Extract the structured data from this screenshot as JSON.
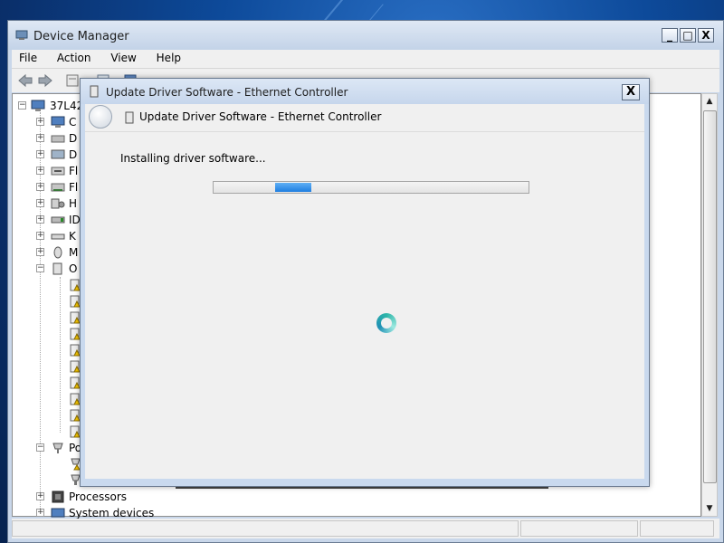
{
  "device_manager": {
    "title": "Device Manager",
    "menu": [
      "File",
      "Action",
      "View",
      "Help"
    ],
    "caption_buttons": {
      "minimize": "_",
      "maximize": "□",
      "close": "X"
    },
    "tree": {
      "root": "37L42",
      "nodes": [
        {
          "label": "C",
          "icon": "computer-icon",
          "expanded": false
        },
        {
          "label": "D",
          "icon": "disk-drive-icon",
          "expanded": false
        },
        {
          "label": "D",
          "icon": "display-adapter-icon",
          "expanded": false
        },
        {
          "label": "Fl",
          "icon": "floppy-drive-icon",
          "expanded": false
        },
        {
          "label": "Fl",
          "icon": "floppy-controller-icon",
          "expanded": false
        },
        {
          "label": "H",
          "icon": "hid-icon",
          "expanded": false
        },
        {
          "label": "ID",
          "icon": "ide-controller-icon",
          "expanded": false
        },
        {
          "label": "K",
          "icon": "keyboard-icon",
          "expanded": false
        },
        {
          "label": "M",
          "icon": "mouse-icon",
          "expanded": false
        },
        {
          "label": "O",
          "icon": "other-devices-icon",
          "expanded": true
        },
        {
          "label": "Po",
          "icon": "ports-icon",
          "expanded": true
        },
        {
          "label": "Processors",
          "icon": "processor-icon",
          "expanded": false
        },
        {
          "label": "System devices",
          "icon": "system-devices-icon",
          "expanded": false
        }
      ]
    }
  },
  "dialog": {
    "title": "Update Driver Software - Ethernet Controller",
    "header": "Update Driver Software - Ethernet Controller",
    "close": "X",
    "status": "Installing driver software...",
    "progress_state": "indeterminate",
    "accent_color": "#1e7ee0"
  }
}
